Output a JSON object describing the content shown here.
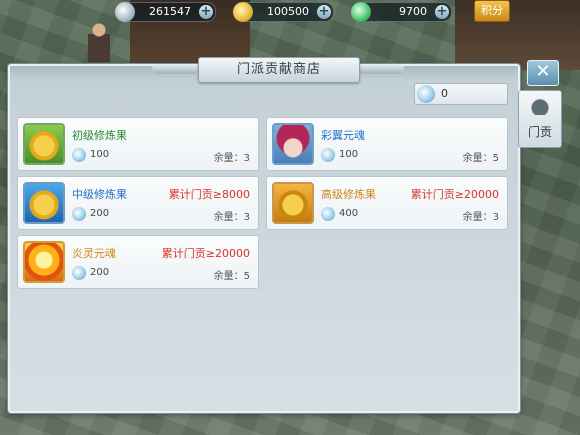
{
  "currency": {
    "silver": "261547",
    "gold": "100500",
    "jade": "9700",
    "score_label": "积分"
  },
  "panel": {
    "title": "门派贡献商店",
    "close": "✕",
    "points": "0",
    "side_tab": "门贡"
  },
  "items": [
    {
      "name": "初级修炼果",
      "price": "100",
      "stock": "余量：3",
      "requirement": ""
    },
    {
      "name": "彩翼元魂",
      "price": "100",
      "stock": "余量：5",
      "requirement": ""
    },
    {
      "name": "中级修炼果",
      "price": "200",
      "stock": "余量：3",
      "requirement": "累计门贡≥8000"
    },
    {
      "name": "高级修炼果",
      "price": "400",
      "stock": "余量：3",
      "requirement": "累计门贡≥20000"
    },
    {
      "name": "炎灵元魂",
      "price": "200",
      "stock": "余量：5",
      "requirement": "累计门贡≥20000"
    }
  ]
}
